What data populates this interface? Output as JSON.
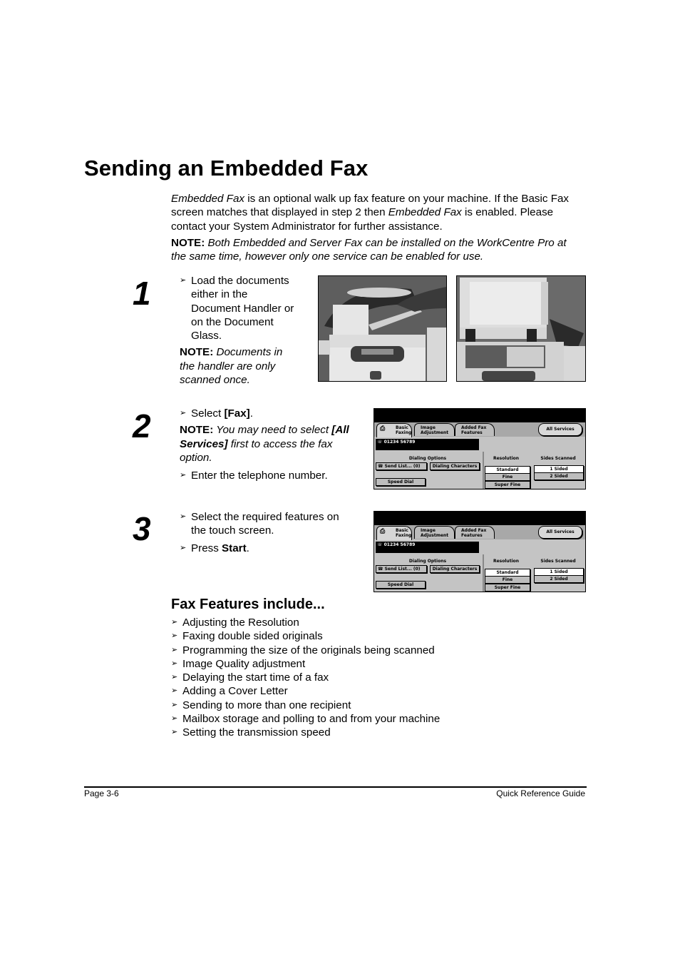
{
  "page": {
    "title": "Sending an Embedded Fax",
    "intro": {
      "parts": [
        {
          "text": "Embedded Fax",
          "italic": true
        },
        {
          "text": " is an optional walk up fax feature on your machine. If the Basic Fax screen matches that displayed in step 2 then ",
          "italic": false
        },
        {
          "text": "Embedded Fax",
          "italic": true
        },
        {
          "text": " is enabled. Please contact your System Administrator for further assistance.",
          "italic": false
        }
      ],
      "line1_a": "Embedded Fax",
      "line1_b": " is an optional walk up fax feature on your machine. If the Basic Fax",
      "line2_a": "screen matches that displayed in step 2 then ",
      "line2_b": "Embedded Fax",
      "line2_c": " is enabled. Please",
      "line3": "contact your System Administrator for further assistance."
    },
    "intro_note": {
      "label": "NOTE:",
      "line1": " Both Embedded and Server Fax can be installed on the WorkCentre Pro at",
      "line2": "the same time, however only one service can be enabled for use."
    }
  },
  "steps": [
    {
      "number": "1",
      "bullets": [
        "Load the documents either in the Document Handler or on the Document Glass."
      ],
      "bullet_lines": [
        "Load the documents",
        "either in the",
        "Document Handler or",
        "on the Document",
        "Glass."
      ],
      "note_label": "NOTE:",
      "note_lines": [
        "Documents in",
        "the handler are only",
        "scanned once."
      ],
      "images": [
        "photo-document-handler",
        "photo-document-glass"
      ]
    },
    {
      "number": "2",
      "bullet1_a": "Select ",
      "bullet1_b": "[Fax]",
      "bullet1_c": ".",
      "note_label": "NOTE:",
      "note_line1_a": " You may need to select ",
      "note_line1_b": "[All",
      "note_line2_a": "Services]",
      "note_line2_b": " first to access the fax",
      "note_line3": "option.",
      "bullet2": "Enter the telephone number."
    },
    {
      "number": "3",
      "bullet1_lines": [
        "Select the required features on",
        "the touch screen."
      ],
      "bullet2_a": "Press ",
      "bullet2_b": "Start",
      "bullet2_c": "."
    }
  ],
  "fax_screen": {
    "tabs": [
      {
        "line1": "Basic",
        "line2": "Faxing",
        "active": true
      },
      {
        "line1": "Image",
        "line2": "Adjustment",
        "active": false
      },
      {
        "line1": "Added Fax",
        "line2": "Features",
        "active": false
      }
    ],
    "all_services": "All Services",
    "number_display": "☏ 01234 56789",
    "dialing_options_label": "Dialing Options",
    "send_list": "☎ Send List... (0)",
    "dialing_characters": "Dialing Characters",
    "speed_dial": "Speed Dial",
    "resolution_label": "Resolution",
    "resolution_options": [
      "Standard",
      "Fine",
      "Super Fine"
    ],
    "resolution_selected": "Standard",
    "sides_label": "Sides Scanned",
    "sides_options": [
      "1 Sided",
      "2 Sided"
    ],
    "sides_selected": "1 Sided"
  },
  "features": {
    "heading": "Fax Features include...",
    "items": [
      "Adjusting the Resolution",
      "Faxing double sided originals",
      "Programming the size of the originals being scanned",
      "Image Quality adjustment",
      "Delaying the start time of a fax",
      "Adding a Cover Letter",
      "Sending to more than one recipient",
      "Mailbox storage and polling to and from your machine",
      "Setting the transmission speed"
    ]
  },
  "bullet_glyph": "➢",
  "footer": {
    "left": "Page 3-6",
    "right": "Quick Reference Guide"
  }
}
